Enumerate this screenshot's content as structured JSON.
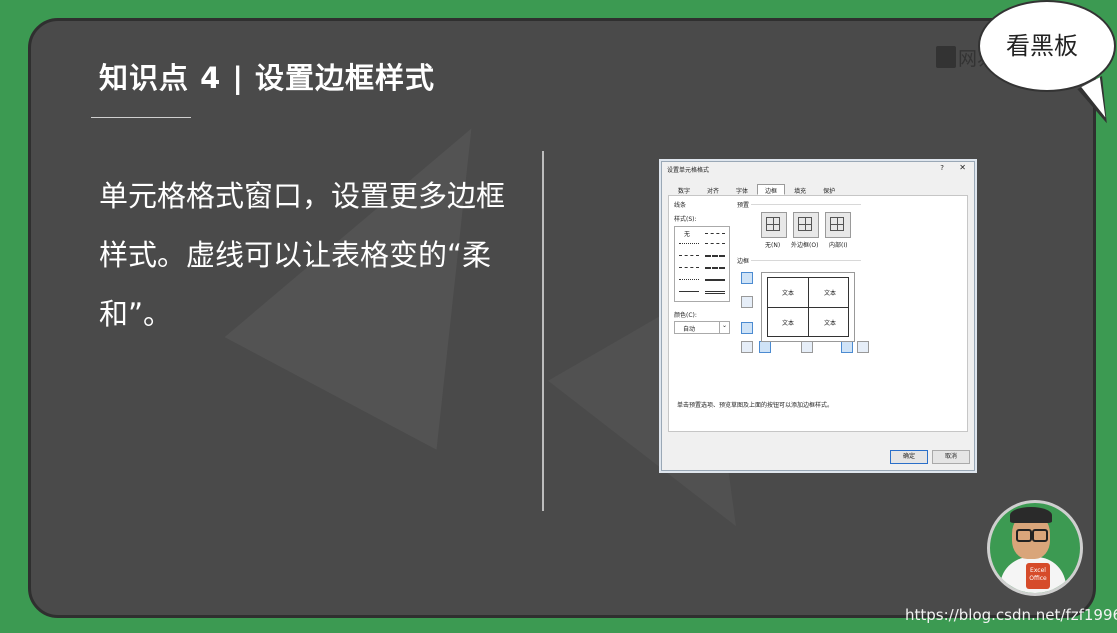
{
  "slide": {
    "title": "知识点 4 | 设置边框样式",
    "body": "单元格格式窗口，设置更多边框样式。虚线可以让表格变的“柔和”。"
  },
  "bubble": {
    "text": "看黑板"
  },
  "brand": {
    "text": "网易云课堂"
  },
  "avatar": {
    "badge": "Excel Office"
  },
  "watermark": "https://blog.csdn.net/fzf1996",
  "dialog": {
    "title": "设置单元格格式",
    "help": "?",
    "close": "✕",
    "tabs": [
      "数字",
      "对齐",
      "字体",
      "边框",
      "填充",
      "保护"
    ],
    "line_group": "线条",
    "style_label": "样式(S):",
    "none_style": "无",
    "color_label": "颜色(C):",
    "color_value": "自动",
    "preset_group": "预置",
    "presets": [
      "无(N)",
      "外边框(O)",
      "内部(I)"
    ],
    "border_group": "边框",
    "preview_cells": [
      "文本",
      "文本",
      "文本",
      "文本"
    ],
    "hint": "单击预置选项、预览草图及上面的按钮可以添加边框样式。",
    "ok": "确定",
    "cancel": "取消"
  },
  "colors": {
    "frame": "#3c9a52",
    "board": "#4a4a4a",
    "text": "#ffffff"
  }
}
